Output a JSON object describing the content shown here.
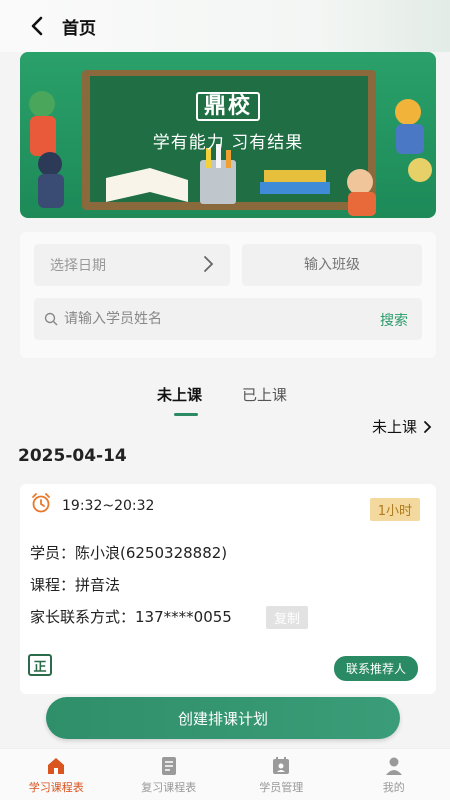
{
  "header": {
    "title": "首页"
  },
  "banner": {
    "logo_text": "鼎校",
    "slogan": "学有能力 习有结果"
  },
  "filters": {
    "date_placeholder": "选择日期",
    "class_placeholder": "输入班级",
    "student_placeholder": "请输入学员姓名",
    "search_label": "搜索"
  },
  "tabs": [
    {
      "label": "未上课",
      "active": true
    },
    {
      "label": "已上课",
      "active": false
    }
  ],
  "status_link": "未上课",
  "date_heading": "2025-04-14",
  "lesson": {
    "time": "19:32~20:32",
    "duration": "1小时",
    "student_label": "学员：",
    "student_value": "陈小浪(6250328882)",
    "course_label": "课程：",
    "course_value": "拼音法",
    "contact_label": "家长联系方式：",
    "contact_value": "137****0055",
    "copy_label": "复制",
    "badge": "正",
    "referrer_label": "联系推荐人"
  },
  "create_button": "创建排课计划",
  "bottom_nav": [
    {
      "label": "学习课程表",
      "icon": "home-icon",
      "active": true
    },
    {
      "label": "复习课程表",
      "icon": "document-icon",
      "active": false
    },
    {
      "label": "学员管理",
      "icon": "calendar-user-icon",
      "active": false
    },
    {
      "label": "我的",
      "icon": "person-icon",
      "active": false
    }
  ],
  "colors": {
    "primary_green": "#2a8a63",
    "nav_active": "#d9541e",
    "badge_bg": "#f3d99d"
  }
}
